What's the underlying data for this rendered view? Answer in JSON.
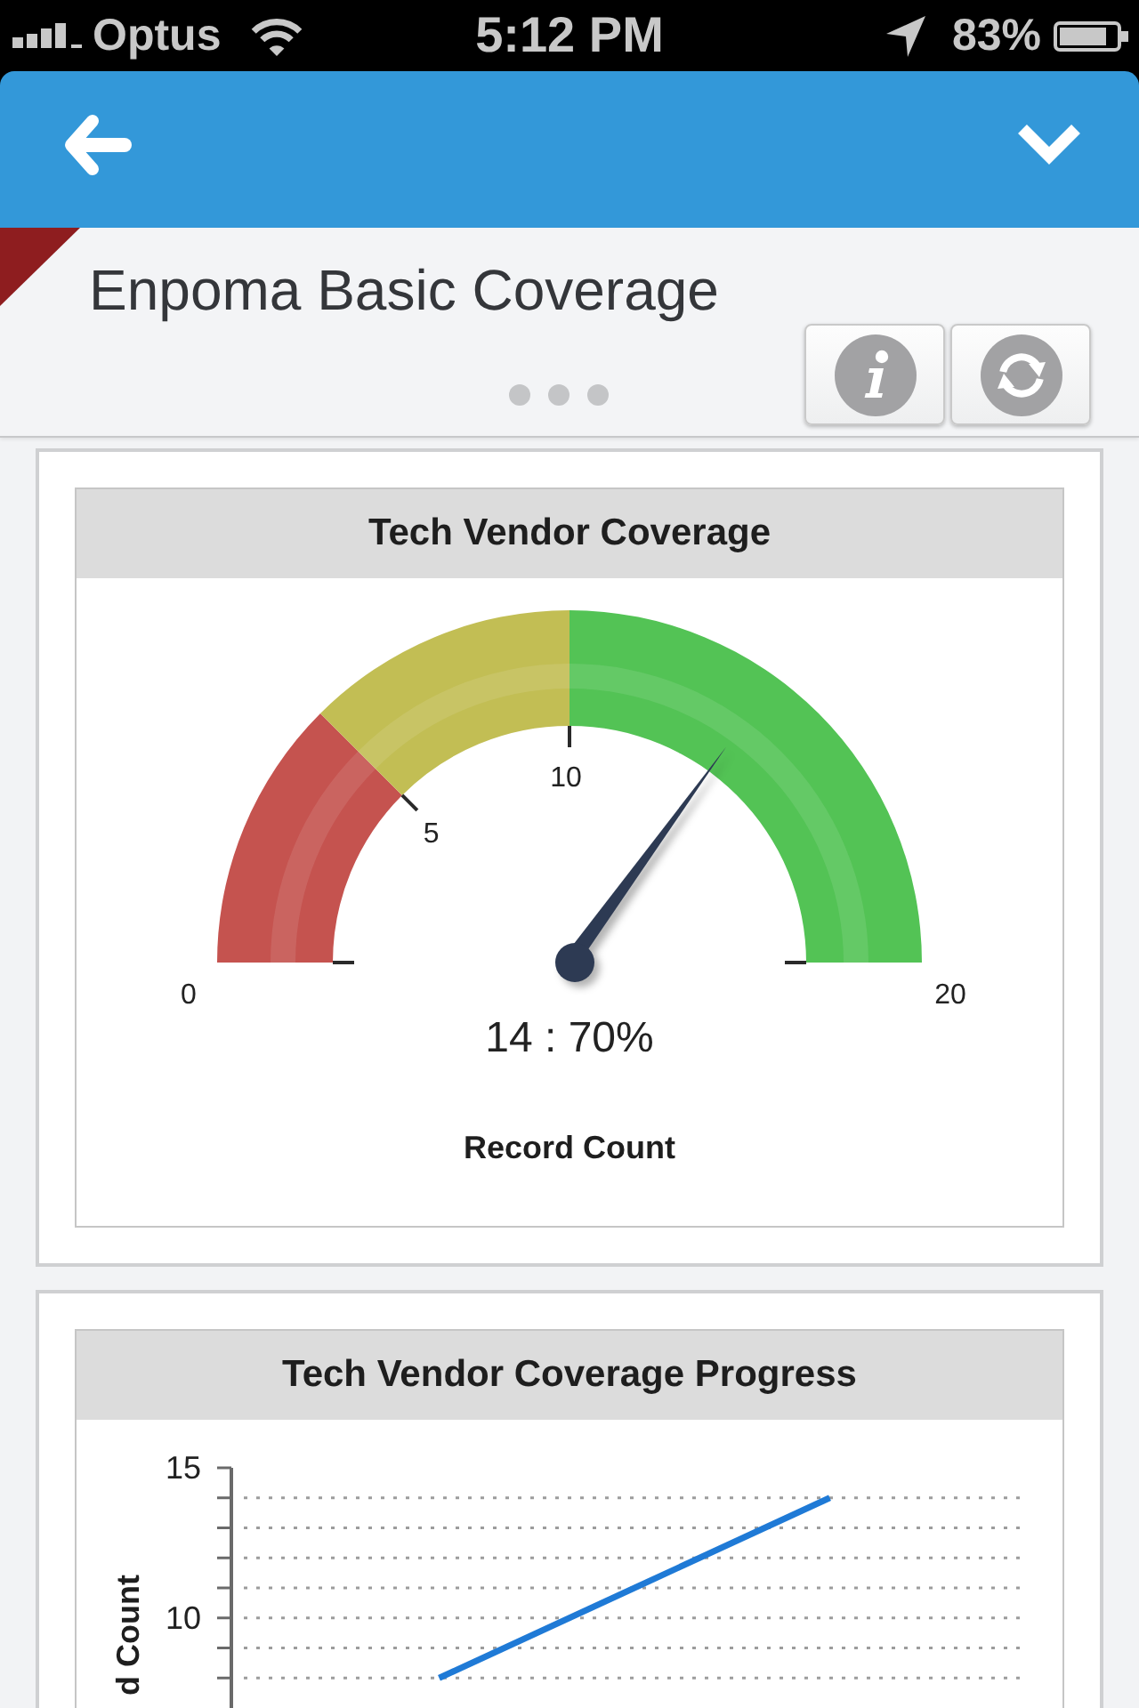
{
  "status_bar": {
    "carrier": "Optus",
    "time": "5:12 PM",
    "battery": "83%"
  },
  "header": {
    "title": "Enpoma Basic Coverage"
  },
  "cards": [
    {
      "kind": "gauge",
      "title": "Tech Vendor Coverage",
      "gauge": {
        "ticks": [
          "0",
          "5",
          "10",
          "20"
        ],
        "bands": [
          {
            "color": "#c5534f"
          },
          {
            "color": "#c2be54"
          },
          {
            "color": "#53c355"
          }
        ],
        "reading": "14 : 70%",
        "axis_label": "Record Count"
      }
    },
    {
      "kind": "line",
      "title": "Tech Vendor Coverage Progress",
      "chart_data": {
        "type": "line",
        "ylabel": "d Count",
        "ylim": [
          7,
          15
        ],
        "yticks": [
          10,
          15
        ],
        "series": [
          {
            "color": "#1f7ad6",
            "values": [
              8,
              14
            ]
          }
        ]
      }
    }
  ]
}
